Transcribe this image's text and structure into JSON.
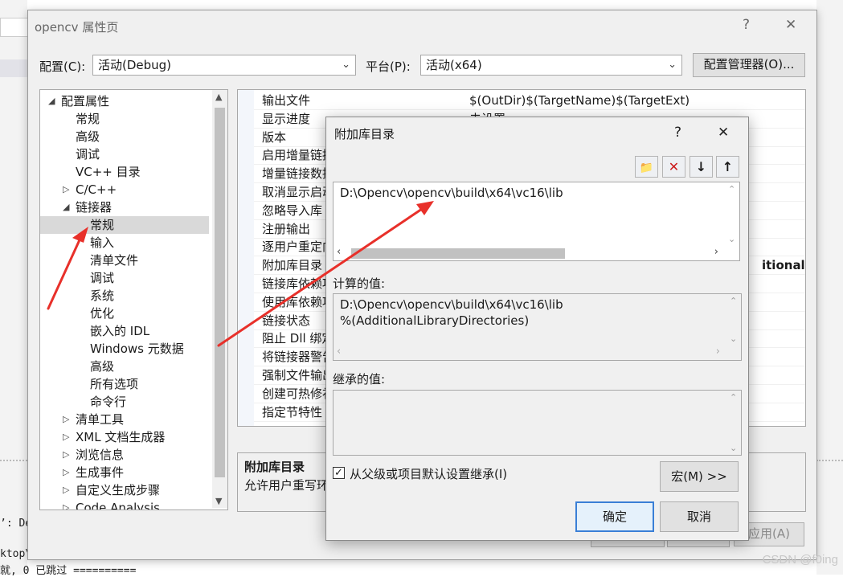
{
  "background": {
    "console_lines": [
      "’: De",
      "ktop\\",
      "就, 0 已跳过 =========="
    ],
    "watermark": "CSDN @f0ing"
  },
  "main_window": {
    "title": "opencv 属性页",
    "help": "?",
    "close": "✕",
    "config_label": "配置(C):",
    "config_value": "活动(Debug)",
    "platform_label": "平台(P):",
    "platform_value": "活动(x64)",
    "config_manager": "配置管理器(O)...",
    "apply": "应用(A)",
    "tree": [
      {
        "label": "配置属性",
        "level": 0,
        "twisty": "◢"
      },
      {
        "label": "常规",
        "level": 1
      },
      {
        "label": "高级",
        "level": 1
      },
      {
        "label": "调试",
        "level": 1
      },
      {
        "label": "VC++ 目录",
        "level": 1
      },
      {
        "label": "C/C++",
        "level": 1,
        "twisty": "▷"
      },
      {
        "label": "链接器",
        "level": 1,
        "twisty": "◢"
      },
      {
        "label": "常规",
        "level": 2,
        "selected": true
      },
      {
        "label": "输入",
        "level": 2
      },
      {
        "label": "清单文件",
        "level": 2
      },
      {
        "label": "调试",
        "level": 2
      },
      {
        "label": "系统",
        "level": 2
      },
      {
        "label": "优化",
        "level": 2
      },
      {
        "label": "嵌入的 IDL",
        "level": 2
      },
      {
        "label": "Windows 元数据",
        "level": 2
      },
      {
        "label": "高级",
        "level": 2
      },
      {
        "label": "所有选项",
        "level": 2
      },
      {
        "label": "命令行",
        "level": 2
      },
      {
        "label": "清单工具",
        "level": 1,
        "twisty": "▷"
      },
      {
        "label": "XML 文档生成器",
        "level": 1,
        "twisty": "▷"
      },
      {
        "label": "浏览信息",
        "level": 1,
        "twisty": "▷"
      },
      {
        "label": "生成事件",
        "level": 1,
        "twisty": "▷"
      },
      {
        "label": "自定义生成步骤",
        "level": 1,
        "twisty": "▷"
      },
      {
        "label": "Code Analysis",
        "level": 1,
        "twisty": "▷"
      }
    ],
    "properties": [
      {
        "name": "输出文件",
        "value": "$(OutDir)$(TargetName)$(TargetExt)"
      },
      {
        "name": "显示进度",
        "value": "未设置"
      },
      {
        "name": "版本",
        "value": ""
      },
      {
        "name": "启用增量链接",
        "value": ""
      },
      {
        "name": "增量链接数据库",
        "value": ""
      },
      {
        "name": "取消显示启动版权标志",
        "value": ""
      },
      {
        "name": "忽略导入库",
        "value": ""
      },
      {
        "name": "注册输出",
        "value": ""
      },
      {
        "name": "逐用户重定向",
        "value": ""
      },
      {
        "name": "附加库目录",
        "value": "itionalLibr"
      },
      {
        "name": "链接库依赖项",
        "value": ""
      },
      {
        "name": "使用库依赖项输入",
        "value": ""
      },
      {
        "name": "链接状态",
        "value": ""
      },
      {
        "name": "阻止 Dll 绑定",
        "value": ""
      },
      {
        "name": "将链接器警告视为错误",
        "value": ""
      },
      {
        "name": "强制文件输出",
        "value": ""
      },
      {
        "name": "创建可热修补映像",
        "value": ""
      },
      {
        "name": "指定节特性",
        "value": ""
      }
    ],
    "desc_title": "附加库目录",
    "desc_text": "允许用户重写环"
  },
  "dialog": {
    "title": "附加库目录",
    "help": "?",
    "close": "✕",
    "toolbar": {
      "new_folder_icon": "📁",
      "delete_icon": "✕",
      "down_icon": "↓",
      "up_icon": "↑"
    },
    "entry": "D:\\Opencv\\opencv\\build\\x64\\vc16\\lib",
    "computed_label": "计算的值:",
    "computed_lines": [
      "D:\\Opencv\\opencv\\build\\x64\\vc16\\lib",
      "%(AdditionalLibraryDirectories)"
    ],
    "inherited_label": "继承的值:",
    "inherit_checkbox": "从父级或项目默认设置继承(I)",
    "inherit_checked": true,
    "macro_button": "宏(M) >>",
    "ok": "确定",
    "cancel": "取消"
  },
  "annotation_color": "#e8302a"
}
